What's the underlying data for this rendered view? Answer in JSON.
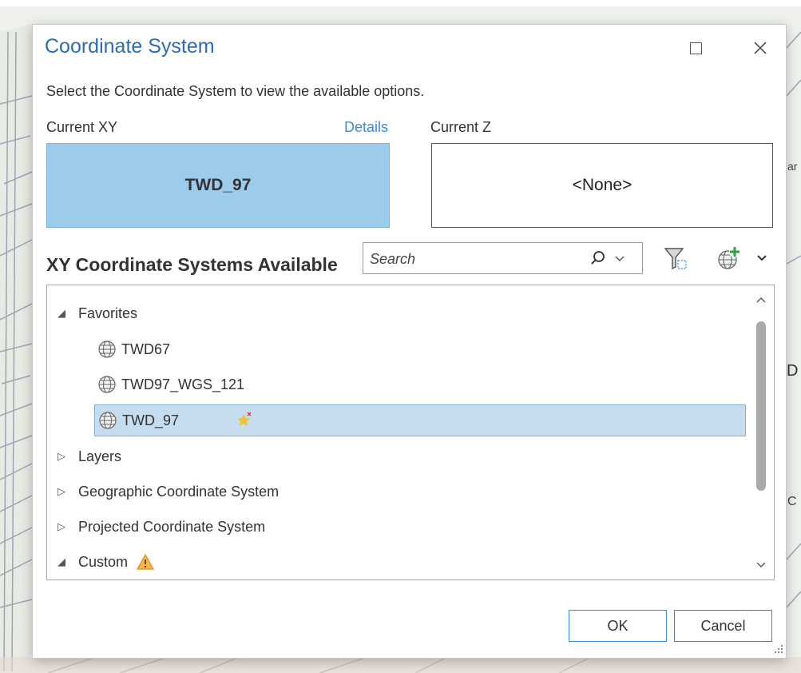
{
  "dialog": {
    "title": "Coordinate System",
    "instruction": "Select the Coordinate System to view the available options."
  },
  "current": {
    "xy_label": "Current XY",
    "details_link": "Details",
    "z_label": "Current Z",
    "xy_value": "TWD_97",
    "z_value": "<None>"
  },
  "available": {
    "heading": "XY Coordinate Systems Available",
    "search_placeholder": "Search"
  },
  "tree": {
    "favorites": "Favorites",
    "fav_items": [
      "TWD67",
      "TWD97_WGS_121",
      "TWD_97"
    ],
    "layers": "Layers",
    "geographic": "Geographic Coordinate System",
    "projected": "Projected Coordinate System",
    "custom": "Custom"
  },
  "buttons": {
    "ok": "OK",
    "cancel": "Cancel"
  },
  "map_fragments": [
    "ar",
    "D",
    "C"
  ],
  "colors": {
    "title": "#2a6cb5",
    "xy_box": "#9ccbec",
    "selected_row": "#c6ddf0",
    "link": "#3d8bd6",
    "warning": "#f0a030"
  },
  "icons": [
    "maximize-icon",
    "close-icon",
    "search-icon",
    "chevron-down-icon",
    "filter-icon",
    "add-globe-icon",
    "globe-icon",
    "favorite-star-icon",
    "warning-icon",
    "resize-grip-icon"
  ]
}
